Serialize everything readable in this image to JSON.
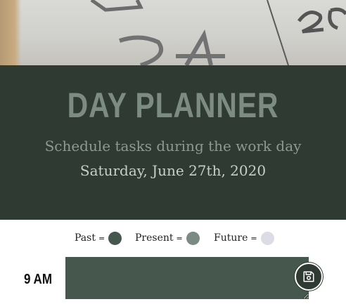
{
  "header": {
    "title": "DAY PLANNER",
    "lead": "Schedule tasks during the work day",
    "current_day": "Saturday, June 27th, 2020"
  },
  "legend": {
    "items": [
      {
        "label": "Past",
        "eq": "=",
        "color": "#46574e"
      },
      {
        "label": "Present",
        "eq": "=",
        "color": "#7b8a83"
      },
      {
        "label": "Future",
        "eq": "=",
        "color": "#dcdce6"
      }
    ]
  },
  "timeblocks": [
    {
      "hour": "9 AM",
      "text": "",
      "state": "past",
      "color": "#46574e",
      "save_icon": "save-icon"
    }
  ],
  "colors": {
    "header_bg": "#2e3a32",
    "title": "#7c8c84",
    "lead": "#8d9a93",
    "current_day": "#c8cec9"
  }
}
